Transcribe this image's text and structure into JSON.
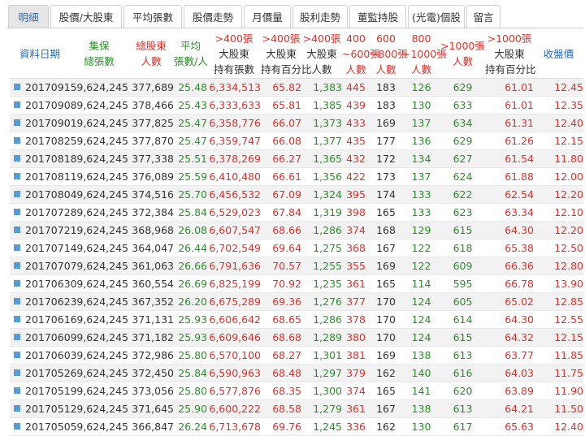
{
  "tabs": [
    {
      "label": "明細",
      "active": true
    },
    {
      "label": "股價/大股東",
      "active": false
    },
    {
      "label": "平均張數",
      "active": false
    },
    {
      "label": "股價走勢",
      "active": false
    },
    {
      "label": "月價量",
      "active": false
    },
    {
      "label": "股利走勢",
      "active": false
    },
    {
      "label": "董監持股",
      "active": false
    },
    {
      "label": "(光電)個股",
      "active": false
    },
    {
      "label": "留言",
      "active": false
    }
  ],
  "colors": {
    "blue": "#2a6db5",
    "red": "#e0302a",
    "green": "#2a8f2a",
    "row_marker": "#5b9bd5"
  },
  "columns": [
    {
      "lines": [
        "資料日期"
      ],
      "color": "blue"
    },
    {
      "lines": [
        "集保",
        "總張數"
      ],
      "color": "green"
    },
    {
      "lines": [
        "總股東",
        "人數"
      ],
      "color": "red"
    },
    {
      "lines": [
        "平均",
        "張數/人"
      ],
      "color": "green"
    },
    {
      "lines": [
        ">400張",
        "大股東",
        "持有張數"
      ],
      "color": "red",
      "dark_from": 1
    },
    {
      "lines": [
        ">400張",
        "大股東",
        "持有百分比"
      ],
      "color": "red",
      "dark_from": 1
    },
    {
      "lines": [
        ">400張",
        "大股東",
        "人數"
      ],
      "color": "red",
      "dark_from": 1
    },
    {
      "lines": [
        "400",
        "~600張",
        "人數"
      ],
      "color": "red"
    },
    {
      "lines": [
        "600",
        "~800張",
        "人數"
      ],
      "color": "red"
    },
    {
      "lines": [
        "800",
        "~1000張",
        "人數"
      ],
      "color": "red"
    },
    {
      "lines": [
        ">1000張",
        "人數"
      ],
      "color": "red"
    },
    {
      "lines": [
        ">1000張",
        "大股東",
        "持有百分比"
      ],
      "color": "red",
      "dark_from": 1
    },
    {
      "lines": [
        "收盤價"
      ],
      "color": "blue"
    }
  ],
  "rows": [
    [
      "20170915",
      "9,624,245",
      "377,689",
      "25.48",
      "6,334,513",
      "65.82",
      "1,383",
      "445",
      "183",
      "126",
      "629",
      "61.01",
      "12.45"
    ],
    [
      "20170908",
      "9,624,245",
      "378,466",
      "25.43",
      "6,333,633",
      "65.81",
      "1,385",
      "439",
      "183",
      "130",
      "633",
      "61.01",
      "12.35"
    ],
    [
      "20170901",
      "9,624,245",
      "377,825",
      "25.47",
      "6,358,776",
      "66.07",
      "1,373",
      "433",
      "169",
      "137",
      "634",
      "61.31",
      "12.40"
    ],
    [
      "20170825",
      "9,624,245",
      "377,870",
      "25.47",
      "6,359,747",
      "66.08",
      "1,377",
      "435",
      "177",
      "136",
      "629",
      "61.26",
      "12.15"
    ],
    [
      "20170818",
      "9,624,245",
      "377,338",
      "25.51",
      "6,378,269",
      "66.27",
      "1,365",
      "432",
      "172",
      "134",
      "627",
      "61.54",
      "11.80"
    ],
    [
      "20170811",
      "9,624,245",
      "376,089",
      "25.59",
      "6,410,480",
      "66.61",
      "1,356",
      "422",
      "173",
      "137",
      "624",
      "61.88",
      "12.00"
    ],
    [
      "20170804",
      "9,624,245",
      "374,516",
      "25.70",
      "6,456,532",
      "67.09",
      "1,324",
      "395",
      "174",
      "133",
      "622",
      "62.54",
      "12.20"
    ],
    [
      "20170728",
      "9,624,245",
      "372,384",
      "25.84",
      "6,529,023",
      "67.84",
      "1,319",
      "398",
      "165",
      "133",
      "623",
      "63.34",
      "12.10"
    ],
    [
      "20170721",
      "9,624,245",
      "368,968",
      "26.08",
      "6,607,547",
      "68.66",
      "1,286",
      "374",
      "168",
      "129",
      "615",
      "64.30",
      "12.20"
    ],
    [
      "20170714",
      "9,624,245",
      "364,047",
      "26.44",
      "6,702,549",
      "69.64",
      "1,275",
      "368",
      "167",
      "122",
      "618",
      "65.38",
      "12.50"
    ],
    [
      "20170707",
      "9,624,245",
      "361,063",
      "26.66",
      "6,791,636",
      "70.57",
      "1,255",
      "355",
      "169",
      "122",
      "609",
      "66.36",
      "12.80"
    ],
    [
      "20170630",
      "9,624,245",
      "360,554",
      "26.69",
      "6,825,199",
      "70.92",
      "1,235",
      "361",
      "165",
      "114",
      "595",
      "66.78",
      "13.90"
    ],
    [
      "20170623",
      "9,624,245",
      "367,352",
      "26.20",
      "6,675,289",
      "69.36",
      "1,276",
      "377",
      "170",
      "124",
      "605",
      "65.02",
      "12.85"
    ],
    [
      "20170616",
      "9,624,245",
      "371,131",
      "25.93",
      "6,606,642",
      "68.65",
      "1,286",
      "378",
      "170",
      "124",
      "614",
      "64.30",
      "12.55"
    ],
    [
      "20170609",
      "9,624,245",
      "371,182",
      "25.93",
      "6,609,646",
      "68.68",
      "1,289",
      "380",
      "170",
      "124",
      "615",
      "64.32",
      "12.15"
    ],
    [
      "20170603",
      "9,624,245",
      "372,986",
      "25.80",
      "6,570,100",
      "68.27",
      "1,301",
      "381",
      "169",
      "138",
      "613",
      "63.77",
      "11.85"
    ],
    [
      "20170526",
      "9,624,245",
      "372,450",
      "25.84",
      "6,590,963",
      "68.48",
      "1,297",
      "379",
      "162",
      "140",
      "616",
      "64.03",
      "11.75"
    ],
    [
      "20170519",
      "9,624,245",
      "373,056",
      "25.80",
      "6,577,876",
      "68.35",
      "1,300",
      "374",
      "165",
      "141",
      "620",
      "63.89",
      "11.90"
    ],
    [
      "20170512",
      "9,624,245",
      "371,645",
      "25.90",
      "6,600,222",
      "68.58",
      "1,279",
      "361",
      "167",
      "138",
      "613",
      "64.21",
      "11.50"
    ],
    [
      "20170505",
      "9,624,245",
      "366,847",
      "26.24",
      "6,713,678",
      "69.76",
      "1,245",
      "336",
      "162",
      "130",
      "617",
      "65.63",
      "12.40"
    ]
  ]
}
